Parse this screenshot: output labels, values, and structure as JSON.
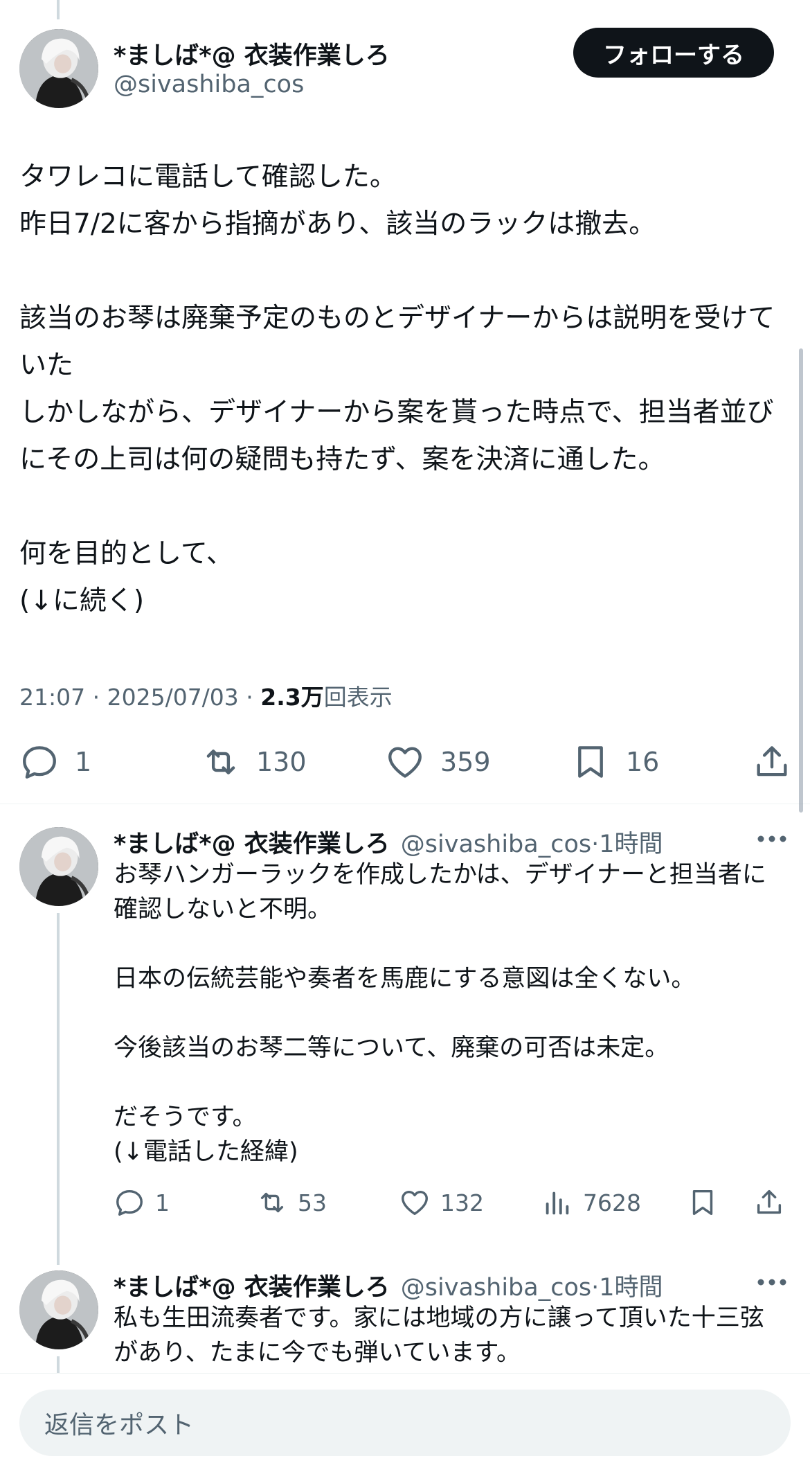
{
  "main_tweet": {
    "display_name": "*ましば*@ 衣装作業しろ",
    "handle": "@sivashiba_cos",
    "follow_label": "フォローする",
    "body": "タワレコに電話して確認した。\n昨日7/2に客から指摘があり、該当のラックは撤去。\n\n該当のお琴は廃棄予定のものとデザイナーからは説明を受けていた\nしかしながら、デザイナーから案を貰った時点で、担当者並びにその上司は何の疑問も持たず、案を決済に通した。\n\n何を目的として、\n(↓に続く)",
    "time": "21:07",
    "separator": " · ",
    "date": "2025/07/03",
    "views_count": "2.3万",
    "views_label": "回表示",
    "replies": "1",
    "reposts": "130",
    "likes": "359",
    "bookmarks": "16"
  },
  "replies": [
    {
      "display_name": "*ましば*@ 衣装作業しろ",
      "handle": "@sivashiba_cos",
      "time": "·1時間",
      "body": "お琴ハンガーラックを作成したかは、デザイナーと担当者に確認しないと不明。\n\n日本の伝統芸能や奏者を馬鹿にする意図は全くない。\n\n今後該当のお琴二等について、廃棄の可否は未定。\n\nだそうです。\n(↓電話した経緯)",
      "replies": "1",
      "reposts": "53",
      "likes": "132",
      "views": "7628"
    },
    {
      "display_name": "*ましば*@ 衣装作業しろ",
      "handle": "@sivashiba_cos",
      "time": "·1時間",
      "body": "私も生田流奏者です。家には地域の方に譲って頂いた十三弦があり、たまに今でも弾いています。"
    }
  ],
  "composer": {
    "placeholder": "返信をポスト"
  },
  "colors": {
    "text": "#0f1419",
    "secondary": "#536471",
    "thread_line": "#cfd9de",
    "follow_bg": "#0f1419",
    "composer_bg": "#eff3f4"
  },
  "icons": [
    "reply-icon",
    "repost-icon",
    "like-icon",
    "bookmark-icon",
    "share-icon",
    "views-icon",
    "more-icon"
  ]
}
